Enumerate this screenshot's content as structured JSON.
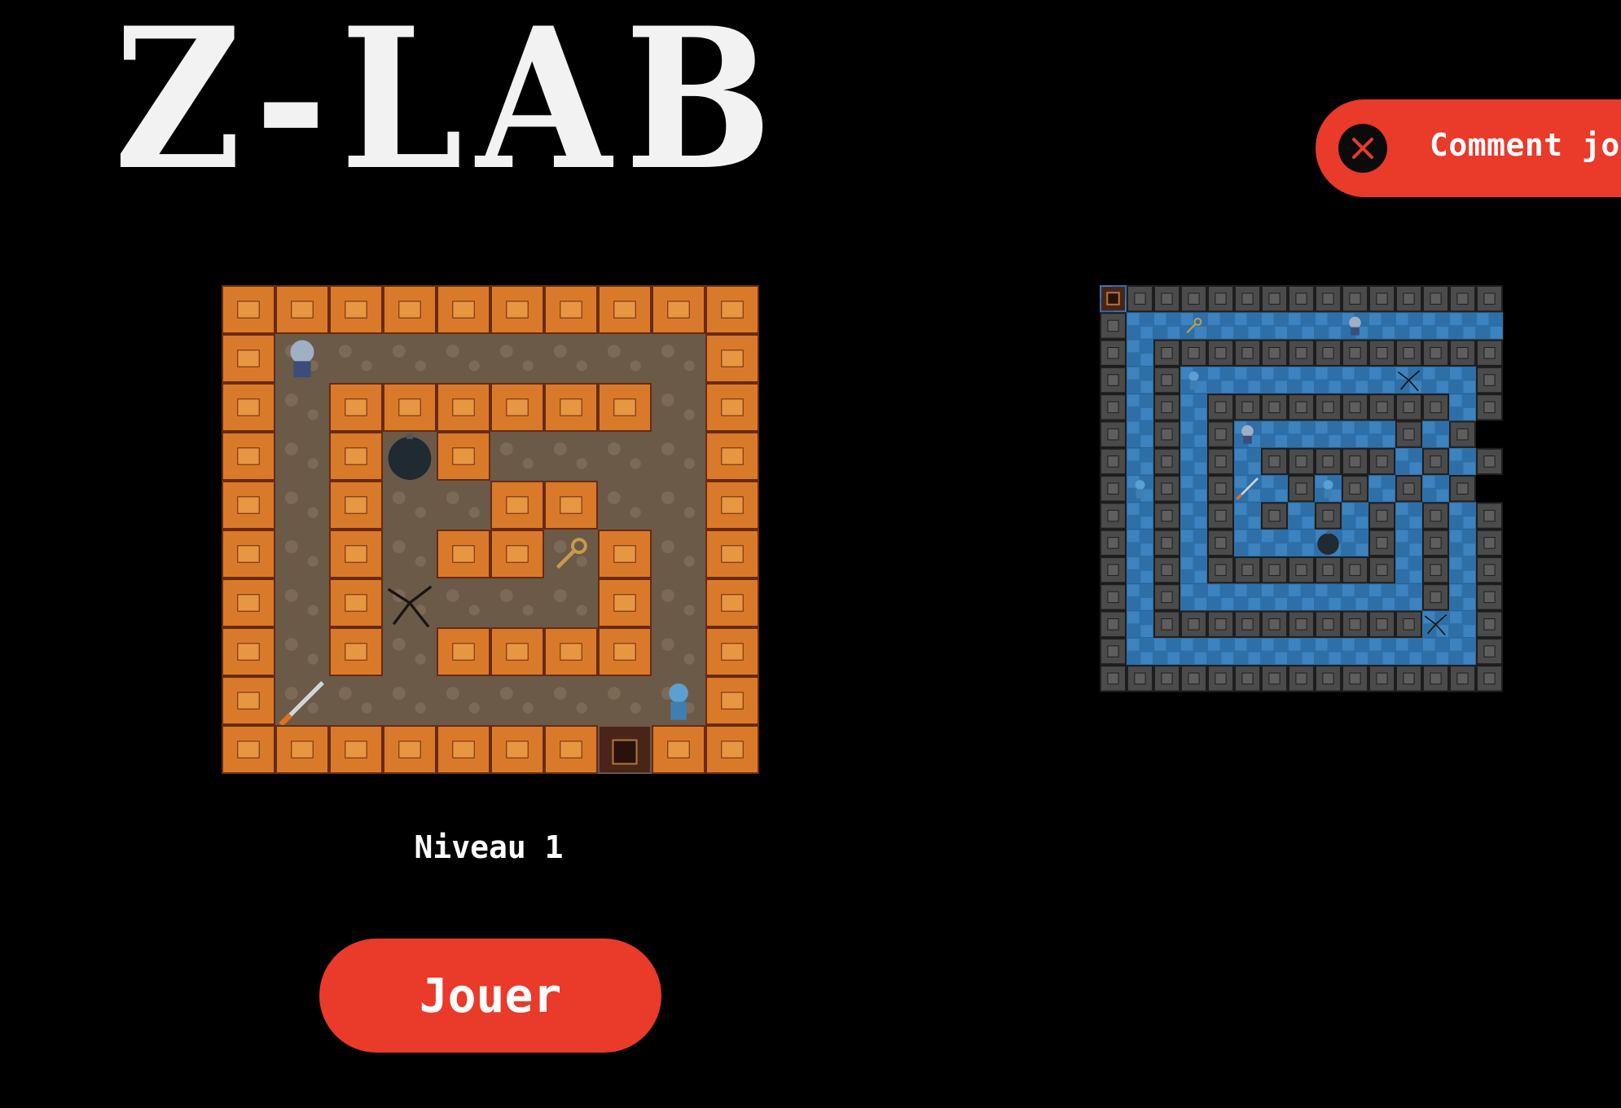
{
  "header": {
    "logo_text": "Z-LAB"
  },
  "help_banner": {
    "label": "Comment jouer",
    "close_icon": "close-icon"
  },
  "level_selector": {
    "current_level_label": "Niveau 1",
    "play_label": "Jouer"
  },
  "colors": {
    "accent": "#e93a2a",
    "background": "#000000",
    "wall_orange": "#d97a2b",
    "floor_brown": "#6b5a48",
    "wall_grey": "#4b4b4b",
    "floor_blue": "#2e6fa8"
  },
  "level_1_map": [
    "##########",
    "#P.......#",
    "#.######.#",
    "#.#O#....#",
    "#.#..##..#",
    "#.#.##K#.#",
    "#.#X...#.#",
    "#.#.####.#",
    "#S......Z#",
    "#######D##"
  ],
  "level_2_map": [
    "D##############",
    "#..K.....P.....#",
    "#.#############",
    "#.#Z.......X..#",
    "#.#.#########.#",
    "#.#.#P.....#.#",
    "#.#.#.#####.#.#",
    "#Z#.#S.#Z#.#.#",
    "#.#.#.#.#.#.#.#",
    "#.#.#...O.#.#.#",
    "#.#.#######.#.#",
    "#.#.........#.#",
    "#.##########X.#",
    "#.............#",
    "###############"
  ],
  "map_legend": {
    "wall": "#",
    "floor": ".",
    "player": "P",
    "zombie": "Z",
    "key": "K",
    "bomb": "O",
    "crack": "X",
    "sword": "S",
    "door": "D"
  }
}
